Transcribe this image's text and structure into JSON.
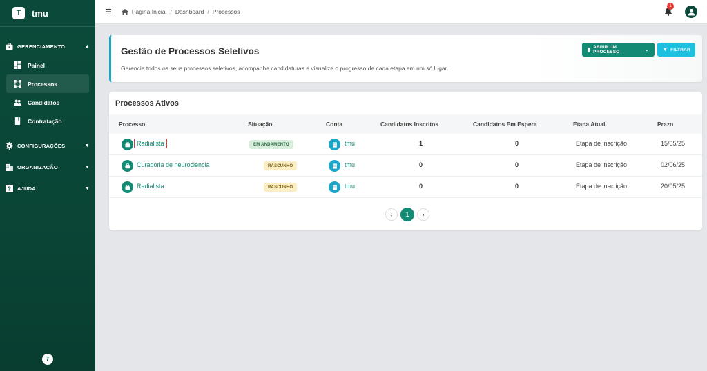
{
  "brand": {
    "logo_letter": "T",
    "name": "tmu"
  },
  "sidebar": {
    "sections": [
      {
        "label": "GERENCIAMENTO",
        "icon": "briefcase-icon",
        "expanded": true
      },
      {
        "label": "CONFIGURAÇÕES",
        "icon": "gear-icon",
        "expanded": false
      },
      {
        "label": "ORGANIZAÇÃO",
        "icon": "building-icon",
        "expanded": false
      },
      {
        "label": "AJUDA",
        "icon": "help-icon",
        "expanded": false
      }
    ],
    "items": [
      {
        "label": "Painel",
        "icon": "dashboard-icon"
      },
      {
        "label": "Processos",
        "icon": "process-icon",
        "active": true
      },
      {
        "label": "Candidatos",
        "icon": "people-icon"
      },
      {
        "label": "Contratação",
        "icon": "book-icon"
      }
    ],
    "footer_logo": "T"
  },
  "topbar": {
    "breadcrumb": [
      "Página Inicial",
      "Dashboard",
      "Processos"
    ],
    "notifications_count": "1"
  },
  "header": {
    "title": "Gestão de Processos Seletivos",
    "description": "Gerencie todos os seus processos seletivos, acompanhe candidaturas e visualize o progresso de cada etapa em um só lugar.",
    "open_button": "ABRIR UM PROCESSO",
    "filter_button": "FILTRAR"
  },
  "table": {
    "title": "Processos Ativos",
    "columns": [
      "Processo",
      "Situação",
      "Conta",
      "Candidatos Inscritos",
      "Candidatos Em Espera",
      "Etapa Atual",
      "Prazo"
    ],
    "rows": [
      {
        "processo": "Radialista",
        "situacao": "EM ANDAMENTO",
        "conta": "tmu",
        "inscritos": "1",
        "espera": "0",
        "etapa": "Etapa de inscrição",
        "prazo": "15/05/25"
      },
      {
        "processo": "Curadoria de neurociencia",
        "situacao": "RASCUNHO",
        "conta": "tmu",
        "inscritos": "0",
        "espera": "0",
        "etapa": "Etapa de inscrição",
        "prazo": "02/06/25"
      },
      {
        "processo": "Radialista",
        "situacao": "RASCUNHO",
        "conta": "tmu",
        "inscritos": "0",
        "espera": "0",
        "etapa": "Etapa de inscrição",
        "prazo": "20/05/25"
      }
    ]
  },
  "pagination": {
    "prev": "‹",
    "current": "1",
    "next": "›"
  },
  "colors": {
    "sidebar": "#0b4a3a",
    "primary": "#138a74",
    "accent": "#1ec0e0",
    "badge": "#e53935"
  }
}
